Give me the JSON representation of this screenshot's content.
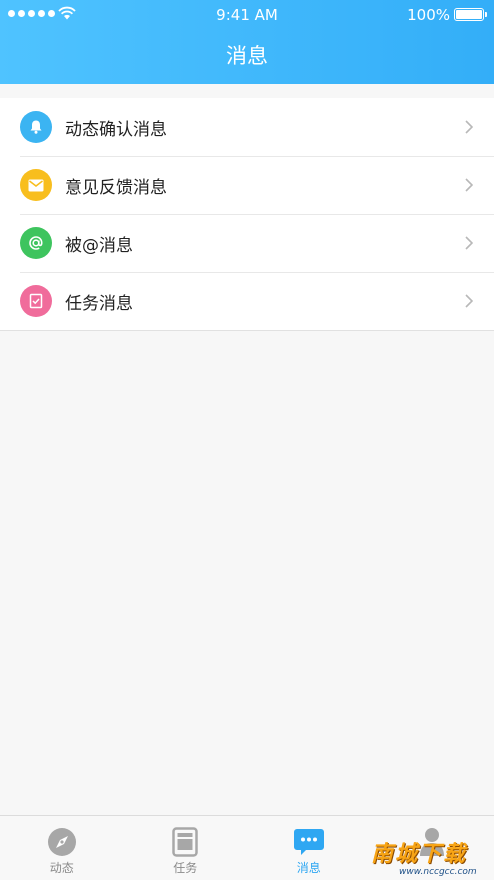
{
  "status_bar": {
    "time": "9:41 AM",
    "battery": "100%"
  },
  "header": {
    "title": "消息"
  },
  "messages": [
    {
      "label": "动态确认消息",
      "icon": "bell-icon",
      "color": "#3bb4f2"
    },
    {
      "label": "意见反馈消息",
      "icon": "envelope-icon",
      "color": "#f8be1e"
    },
    {
      "label": "被@消息",
      "icon": "at-icon",
      "color": "#3ec45e"
    },
    {
      "label": "任务消息",
      "icon": "checklist-icon",
      "color": "#f06c9b"
    }
  ],
  "tabbar": {
    "tabs": [
      {
        "label": "动态",
        "icon": "compass-icon",
        "active": false
      },
      {
        "label": "任务",
        "icon": "task-icon",
        "active": false
      },
      {
        "label": "消息",
        "icon": "chat-bubble-icon",
        "active": true
      },
      {
        "label": "",
        "icon": "person-icon",
        "active": false
      }
    ]
  },
  "watermark": {
    "text": "南城下载",
    "url": "www.nccgcc.com"
  }
}
